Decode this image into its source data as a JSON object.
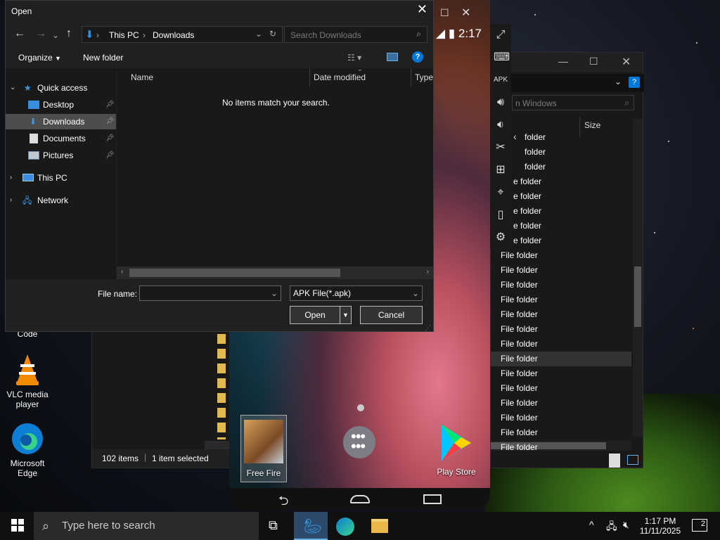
{
  "colors": {
    "accent": "#0078d7",
    "dialog_bg": "#202020",
    "pane_bg": "#191919",
    "selection": "#4d4d4d"
  },
  "dialog": {
    "title": "Open",
    "breadcrumb": [
      "This PC",
      "Downloads"
    ],
    "search_placeholder": "Search Downloads",
    "toolbar": {
      "organize": "Organize",
      "new_folder": "New folder"
    },
    "nav": {
      "quick_access": "Quick access",
      "desktop": "Desktop",
      "downloads": "Downloads",
      "documents": "Documents",
      "pictures": "Pictures",
      "this_pc": "This PC",
      "network": "Network"
    },
    "columns": {
      "name": "Name",
      "date_modified": "Date modified",
      "type": "Type"
    },
    "empty_message": "No items match your search.",
    "file_name_label": "File name:",
    "file_name_value": "",
    "file_type": "APK File(*.apk)",
    "open_label": "Open",
    "cancel_label": "Cancel"
  },
  "phone": {
    "clock": "2:17",
    "apps": {
      "free_fire": "Free Fire",
      "play_store": "Play Store"
    }
  },
  "bg_explorer_right": {
    "search_placeholder": "n Windows",
    "size_header": "Size",
    "rows": [
      "folder",
      "folder",
      "folder",
      "e folder",
      "e folder",
      "e folder",
      "e folder",
      "e folder",
      "File folder",
      "File folder",
      "File folder",
      "File folder",
      "File folder",
      "File folder",
      "File folder",
      "File folder",
      "File folder",
      "File folder",
      "File folder",
      "File folder",
      "File folder",
      "File folder"
    ]
  },
  "bg_explorer_left": {
    "status_items": "102 items",
    "status_selected": "1 item selected"
  },
  "desktop_icons": {
    "code": "Code",
    "vlc": "VLC media player",
    "edge": "Microsoft Edge"
  },
  "taskbar": {
    "search_placeholder": "Type here to search",
    "time": "1:17 PM",
    "date": "11/11/2025",
    "notifications": "2"
  }
}
